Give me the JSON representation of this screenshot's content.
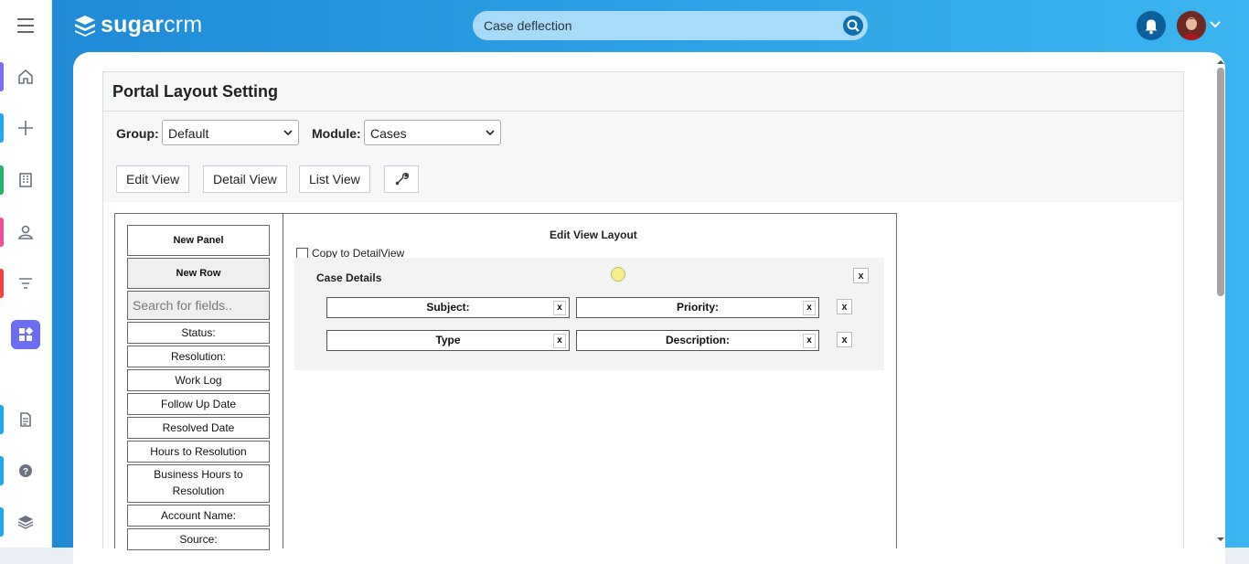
{
  "app": {
    "logo_bold": "sugar",
    "logo_light": "crm",
    "search_value": "Case deflection"
  },
  "nav": {
    "items": [
      {
        "name": "home-icon",
        "color": "#7b6cf6"
      },
      {
        "name": "plus-icon",
        "color": "#21a9f0"
      },
      {
        "name": "building-icon",
        "color": "#22b56b"
      },
      {
        "name": "person-icon",
        "color": "#ef4f9a"
      },
      {
        "name": "filter-icon",
        "color": "#f0423f"
      },
      {
        "name": "dashboard-icon",
        "color": "#6b6ef0"
      },
      {
        "name": "document-icon",
        "color": "#21a9f0"
      },
      {
        "name": "help-icon",
        "color": "#21a9f0"
      },
      {
        "name": "layers-icon",
        "color": "#21a9f0"
      }
    ]
  },
  "page": {
    "title": "Portal Layout Setting",
    "group_label": "Group:",
    "group_value": "Default",
    "module_label": "Module:",
    "module_value": "Cases",
    "views": [
      "Edit View",
      "Detail View",
      "List View"
    ]
  },
  "toolbox": {
    "new_panel": "New Panel",
    "new_row": "New Row",
    "search_placeholder": "Search for fields..",
    "fields": [
      "Status:",
      "Resolution:",
      "Work Log",
      "Follow Up Date",
      "Resolved Date",
      "Hours to Resolution",
      "Business Hours to Resolution",
      "Account Name:",
      "Source:"
    ]
  },
  "layout": {
    "title": "Edit View Layout",
    "copy_label": "Copy to DetailView",
    "panel_name": "Case Details",
    "x": "x",
    "rows": [
      [
        "Subject:",
        "Priority:"
      ],
      [
        "Type",
        "Description:"
      ]
    ]
  }
}
